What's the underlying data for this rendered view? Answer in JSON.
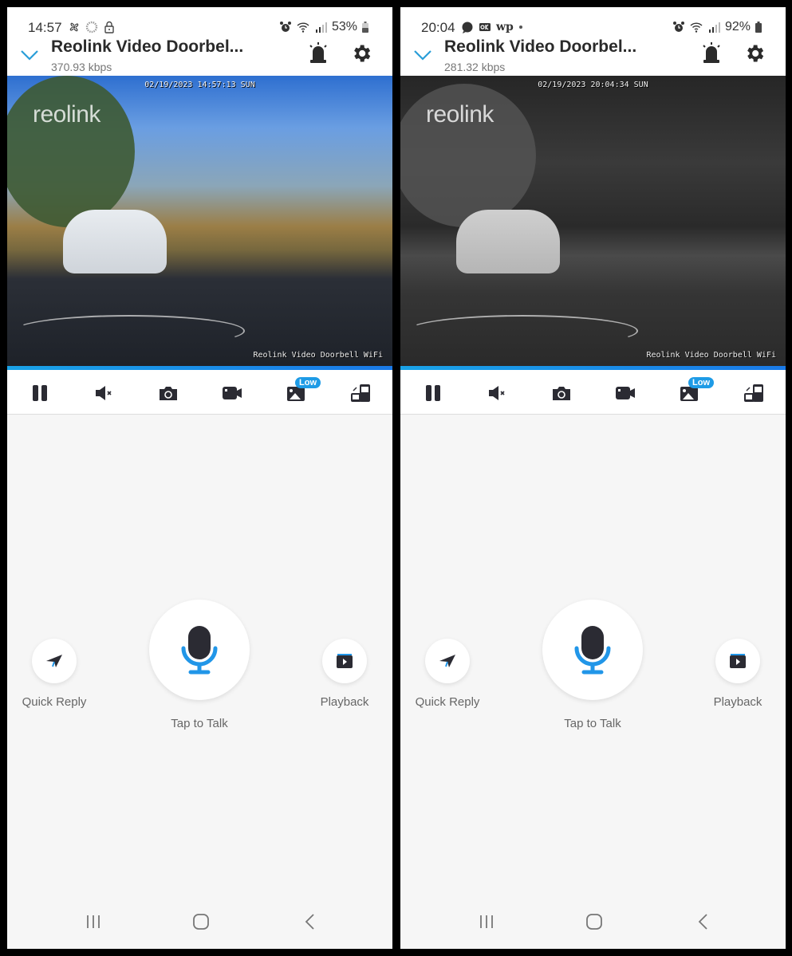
{
  "screens": [
    {
      "status_bar": {
        "time": "14:57",
        "left_icons": [
          "fan-icon",
          "loading-ring-icon",
          "lock-icon"
        ],
        "right_icons": [
          "alarm-icon",
          "wifi-icon",
          "signal-icon"
        ],
        "battery": "53%"
      },
      "header": {
        "title": "Reolink Video Doorbel...",
        "bitrate": "370.93 kbps"
      },
      "video": {
        "mode": "day",
        "watermark": "reolink",
        "timestamp": "02/19/2023 14:57:13 SUN",
        "camera_name": "Reolink Video Doorbell WiFi"
      },
      "toolbar": {
        "quality_badge": "Low"
      },
      "actions": {
        "quick_reply": "Quick Reply",
        "talk": "Tap to Talk",
        "playback": "Playback"
      }
    },
    {
      "status_bar": {
        "time": "20:04",
        "left_icons": [
          "chat-bubble-icon",
          "ok-icon",
          "wp-icon",
          "dot-icon"
        ],
        "left_text": "wp",
        "right_icons": [
          "alarm-icon",
          "wifi-icon",
          "signal-icon"
        ],
        "battery": "92%"
      },
      "header": {
        "title": "Reolink Video Doorbel...",
        "bitrate": "281.32 kbps"
      },
      "video": {
        "mode": "night",
        "watermark": "reolink",
        "timestamp": "02/19/2023 20:04:34 SUN",
        "camera_name": "Reolink Video Doorbell WiFi"
      },
      "toolbar": {
        "quality_badge": "Low"
      },
      "actions": {
        "quick_reply": "Quick Reply",
        "talk": "Tap to Talk",
        "playback": "Playback"
      }
    }
  ],
  "colors": {
    "accent": "#1e9be6",
    "icon_dark": "#2b2b33",
    "mic_blue": "#2196e8"
  }
}
